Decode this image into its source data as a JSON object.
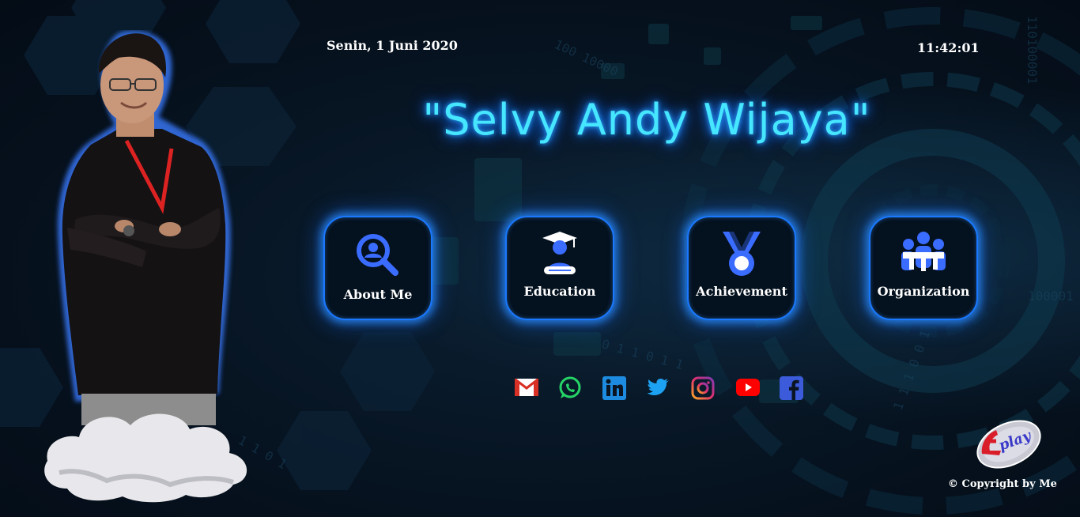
{
  "header": {
    "date": "Senin, 1 Juni 2020",
    "time": "11:42:01"
  },
  "title": "\"Selvy Andy Wijaya\"",
  "menu": [
    {
      "label": "About Me",
      "icon": "search-user-icon"
    },
    {
      "label": "Education",
      "icon": "graduate-icon"
    },
    {
      "label": "Achievement",
      "icon": "medal-icon"
    },
    {
      "label": "Organization",
      "icon": "team-icon"
    }
  ],
  "socials": [
    "gmail-icon",
    "whatsapp-icon",
    "linkedin-icon",
    "twitter-icon",
    "instagram-icon",
    "youtube-icon",
    "facebook-icon"
  ],
  "logo_text": "play",
  "footer": {
    "copyright": "© Copyright by Me"
  },
  "colors": {
    "accent": "#1a78ff",
    "title": "#46e6ff",
    "background": "#06121f"
  }
}
